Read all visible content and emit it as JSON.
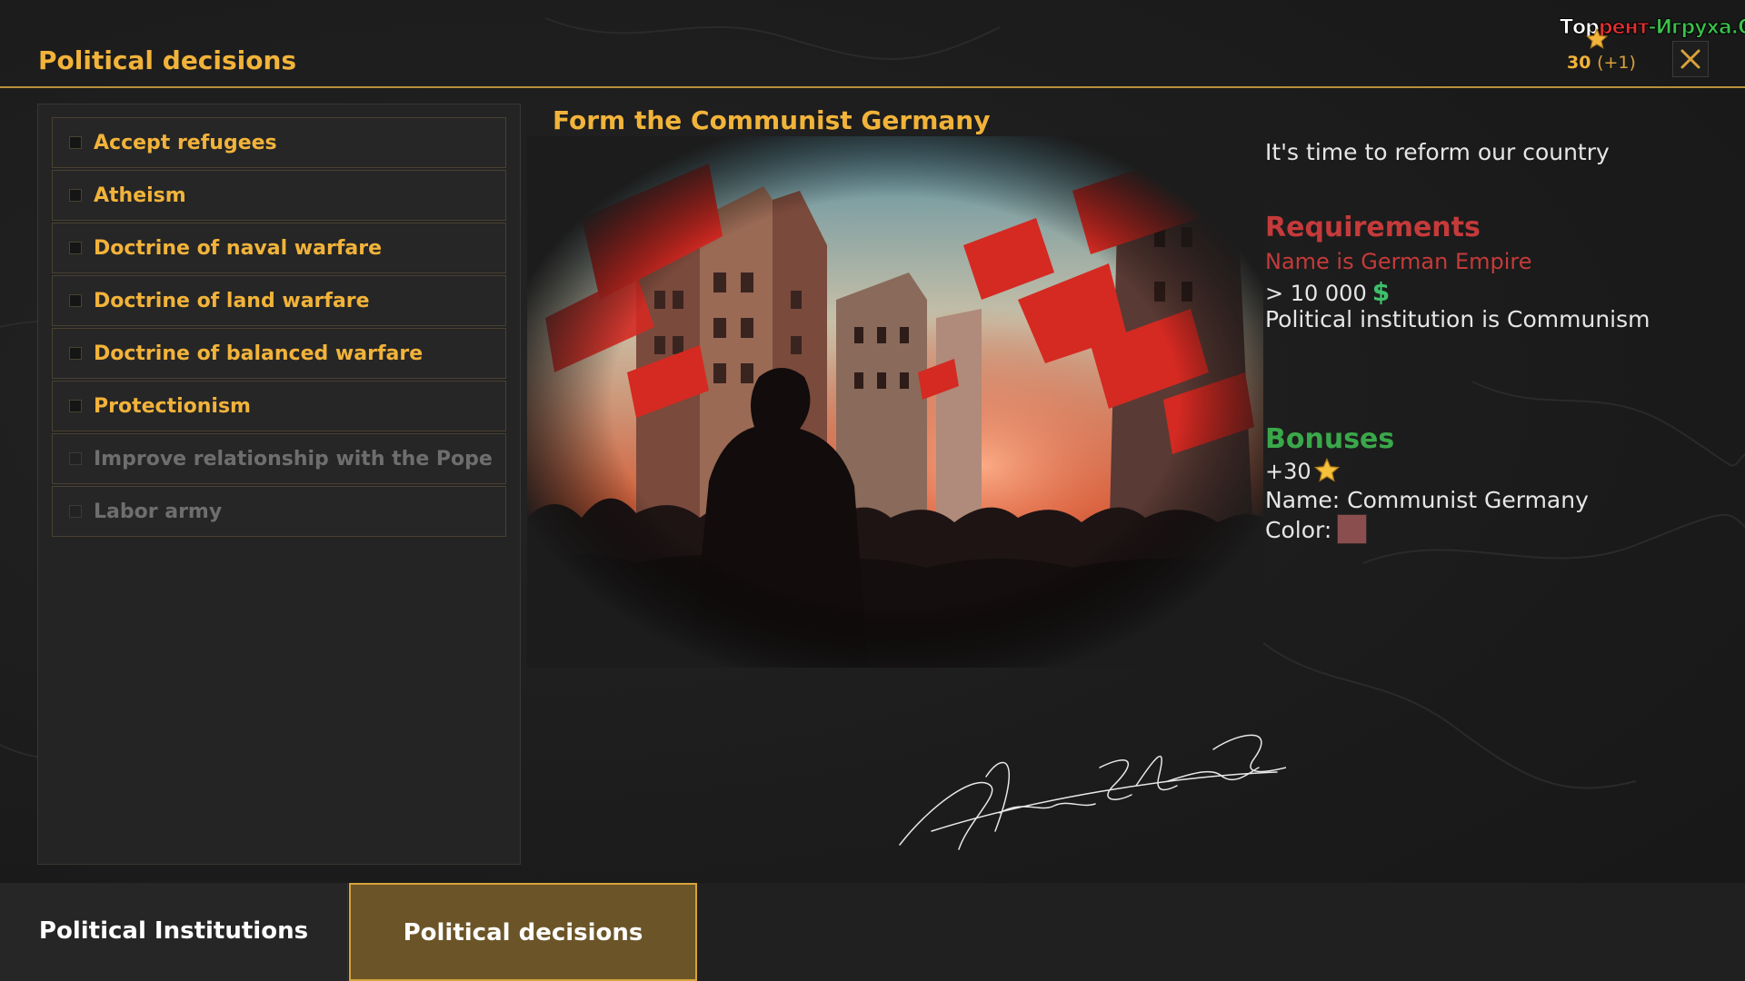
{
  "header": {
    "title": "Political decisions",
    "points": "30",
    "points_delta": "(+1)",
    "points_icon": "star-icon",
    "close_icon": "close-icon",
    "watermark": {
      "part1": "Тор",
      "part2": "рент",
      "part3": "-Игруха.Орг"
    }
  },
  "decisions": {
    "items": [
      {
        "label": "Accept refugees",
        "enabled": true
      },
      {
        "label": "Atheism",
        "enabled": true
      },
      {
        "label": "Doctrine of naval warfare",
        "enabled": true
      },
      {
        "label": "Doctrine of land warfare",
        "enabled": true
      },
      {
        "label": "Doctrine of balanced warfare",
        "enabled": true
      },
      {
        "label": "Protectionism",
        "enabled": true
      },
      {
        "label": "Improve relationship with the Pope",
        "enabled": false
      },
      {
        "label": "Labor army",
        "enabled": false
      }
    ]
  },
  "detail": {
    "title": "Form the Communist Germany",
    "description": "It's time to reform our country",
    "requirements": {
      "heading": "Requirements",
      "name_requirement": "Name is German Empire",
      "money_requirement": "> 10 000",
      "money_icon": "$",
      "institution_requirement": "Political institution is Communism"
    },
    "bonuses": {
      "heading": "Bonuses",
      "points_bonus": "+30",
      "name_bonus": "Name: Communist Germany",
      "color_label": "Color:",
      "color_value": "#8a4e4e"
    }
  },
  "tabs": [
    {
      "label": "Political Institutions",
      "active": false
    },
    {
      "label": "Political decisions",
      "active": true
    }
  ],
  "colors": {
    "accent": "#f2b33a",
    "requirement_red": "#c53a3a",
    "bonus_green": "#3aa84a",
    "active_tab": "#6b5528"
  }
}
